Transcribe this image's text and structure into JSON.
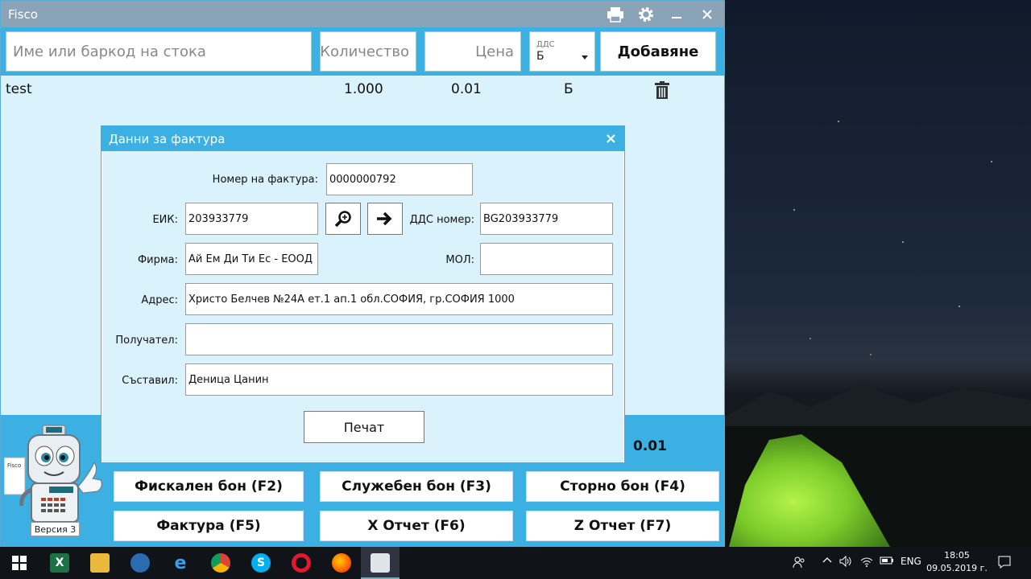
{
  "window": {
    "title": "Fisco"
  },
  "toolbar": {
    "name_placeholder": "Име или баркод на стока",
    "quantity_placeholder": "Количество",
    "price_placeholder": "Цена",
    "vat_label": "ДДС",
    "vat_value": "Б",
    "add_label": "Добавяне"
  },
  "items": [
    {
      "name": "test",
      "quantity": "1.000",
      "price": "0.01",
      "vat": "Б"
    }
  ],
  "total": "0.01",
  "actions": {
    "fiscal": "Фискален бон (F2)",
    "service": "Служебен бон (F3)",
    "storno": "Сторно бон (F4)",
    "invoice": "Фактура (F5)",
    "x_report": "X Отчет (F6)",
    "z_report": "Z Отчет (F7)"
  },
  "version": "Версия 3",
  "dialog": {
    "title": "Данни за фактура",
    "close": "×",
    "invoice_number_label": "Номер на фактура:",
    "invoice_number": "0000000792",
    "eik_label": "ЕИК:",
    "eik": "203933779",
    "vat_number_label": "ДДС номер:",
    "vat_number": "BG203933779",
    "company_label": "Фирма:",
    "company": "Ай Ем Ди Ти Ес - ЕООД",
    "mol_label": "МОЛ:",
    "mol": "",
    "address_label": "Адрес:",
    "address": "Христо Белчев  №24А ет.1 ап.1 обл.СОФИЯ, гр.СОФИЯ 1000",
    "recipient_label": "Получател:",
    "recipient": "",
    "author_label": "Съставил:",
    "author": "Деница Цанин",
    "print_label": "Печат"
  },
  "taskbar": {
    "language": "ENG",
    "time": "18:05",
    "date": "09.05.2019 г."
  },
  "colors": {
    "accent": "#3db0e3",
    "panel": "#d9f2fb",
    "titlebar": "#8aa3b6"
  }
}
